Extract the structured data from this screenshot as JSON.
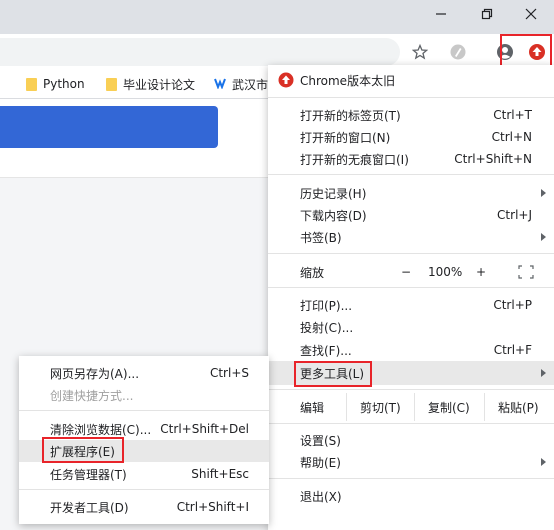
{
  "window": {
    "minimize_glyph": "—",
    "restore_glyph": "❐",
    "close_glyph": "✕"
  },
  "toolbar": {
    "bookmark_star_icon": "star-icon",
    "extension_icon": "extension-icon",
    "profile_icon": "profile-icon",
    "update_icon": "update-arrow-icon"
  },
  "bookmarks": [
    {
      "label": "Python",
      "icon": "folder-icon"
    },
    {
      "label": "毕业设计论文",
      "icon": "folder-icon"
    },
    {
      "label": "武汉市",
      "icon": "site-logo-icon"
    }
  ],
  "menu": {
    "update_banner": "Chrome版本太旧",
    "items_group1": [
      {
        "label": "打开新的标签页(T)",
        "shortcut": "Ctrl+T"
      },
      {
        "label": "打开新的窗口(N)",
        "shortcut": "Ctrl+N"
      },
      {
        "label": "打开新的无痕窗口(I)",
        "shortcut": "Ctrl+Shift+N"
      }
    ],
    "items_group2": [
      {
        "label": "历史记录(H)",
        "shortcut": ""
      },
      {
        "label": "下载内容(D)",
        "shortcut": "Ctrl+J"
      },
      {
        "label": "书签(B)",
        "shortcut": ""
      }
    ],
    "zoom": {
      "label": "缩放",
      "minus": "−",
      "value": "100%",
      "plus": "+"
    },
    "items_group3": [
      {
        "label": "打印(P)...",
        "shortcut": "Ctrl+P"
      },
      {
        "label": "投射(C)...",
        "shortcut": ""
      },
      {
        "label": "查找(F)...",
        "shortcut": "Ctrl+F"
      },
      {
        "label": "更多工具(L)",
        "shortcut": ""
      }
    ],
    "edit": {
      "label": "编辑",
      "cut": "剪切(T)",
      "copy": "复制(C)",
      "paste": "粘贴(P)"
    },
    "items_group4": [
      {
        "label": "设置(S)"
      },
      {
        "label": "帮助(E)"
      }
    ],
    "exit": "退出(X)"
  },
  "submenu": {
    "items": [
      {
        "label": "网页另存为(A)...",
        "shortcut": "Ctrl+S"
      },
      {
        "label": "创建快捷方式...",
        "shortcut": ""
      },
      {
        "label": "清除浏览数据(C)...",
        "shortcut": "Ctrl+Shift+Del"
      },
      {
        "label": "扩展程序(E)",
        "shortcut": ""
      },
      {
        "label": "任务管理器(T)",
        "shortcut": "Shift+Esc"
      },
      {
        "label": "开发者工具(D)",
        "shortcut": "Ctrl+Shift+I"
      }
    ]
  },
  "colors": {
    "highlight_border": "#e8242a",
    "update_badge": "#d93025",
    "page_band": "#3367d6"
  }
}
